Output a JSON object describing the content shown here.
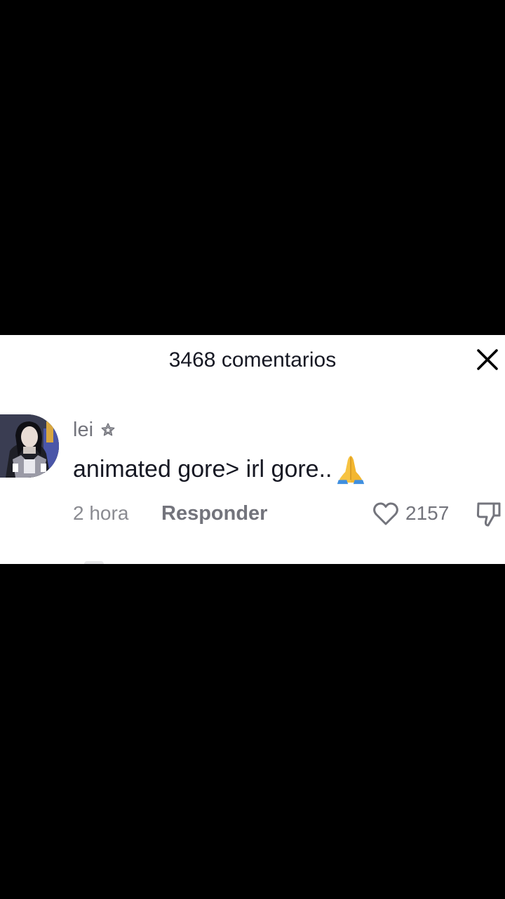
{
  "comments_panel": {
    "title": "3468 comentarios",
    "close_icon": "close-icon"
  },
  "comment": {
    "username": "lei",
    "badge_icon": "star-outline-icon",
    "text": "animated gore> irl gore..",
    "emoji_icon": "folded-hands-emoji",
    "time": "2 hora",
    "reply_label": "Responder",
    "like_icon": "heart-outline-icon",
    "like_count": "2157",
    "dislike_icon": "thumbs-down-icon"
  },
  "colors": {
    "background": "#000000",
    "panel": "#ffffff",
    "primary_text": "#161823",
    "secondary_text": "#73747c"
  }
}
